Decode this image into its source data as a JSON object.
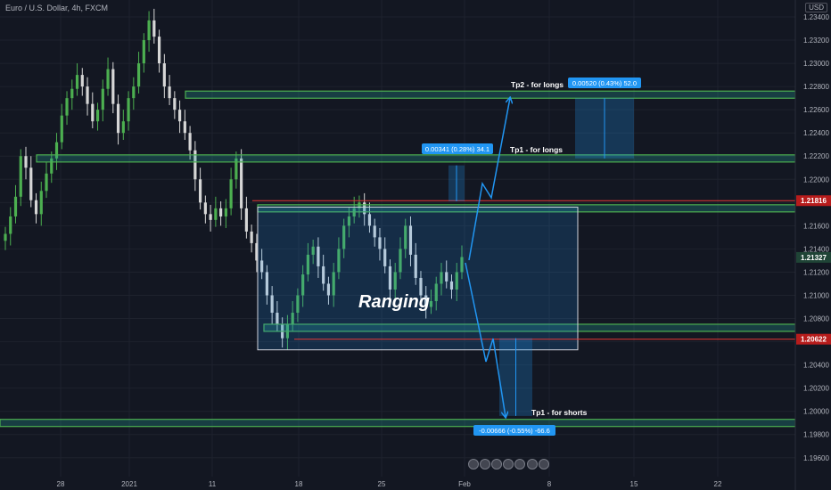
{
  "header": {
    "ticker": "Euro / U.S. Dollar, 4h, FXCM",
    "currency": "USD"
  },
  "chart_data": {
    "type": "candlestick",
    "ylim": [
      1.1946,
      1.234
    ],
    "y_ticks": [
      "1.23400",
      "1.23200",
      "1.23000",
      "1.22800",
      "1.22600",
      "1.22400",
      "1.22200",
      "1.22000",
      "1.21800",
      "1.21600",
      "1.21400",
      "1.21200",
      "1.21000",
      "1.20800",
      "1.20600",
      "1.20400",
      "1.20200",
      "1.20000",
      "1.19800",
      "1.19600"
    ],
    "x_ticks": [
      "28",
      "2021",
      "11",
      "18",
      "25",
      "Feb",
      "8",
      "15",
      "22"
    ],
    "price_badges": [
      {
        "label": "1.21816",
        "value": 1.21816,
        "color": "#b71c1c"
      },
      {
        "label": "1.21327",
        "value": 1.21327,
        "color": "#1f4436"
      },
      {
        "label": "1.20622",
        "value": 1.20622,
        "color": "#b71c1c"
      }
    ],
    "annotations": {
      "ranging": "Ranging",
      "tp2_longs": "Tp2 - for longs",
      "tp1_longs": "Tp1 - for longs",
      "tp1_shorts": "Tp1 - for shorts"
    },
    "measure_labels": {
      "box1": "0.00341 (0.28%) 34.1",
      "box2": "0.00520 (0.43%) 52.0",
      "box3": "-0.00666 (-0.55%) -66.6"
    },
    "levels": {
      "tp2_longs": 1.2273,
      "tp1_longs": 1.2218,
      "range_top": 1.2175,
      "resistance": 1.21816,
      "range_bottom": 1.2072,
      "support": 1.20622,
      "tp1_shorts": 1.199
    },
    "range_box": [
      1.2176,
      1.2053
    ],
    "series": [
      {
        "values": [
          1.2153,
          1.2168,
          1.2185,
          1.222,
          1.221,
          1.2182,
          1.217,
          1.219,
          1.2205,
          1.2218,
          1.2232,
          1.2255,
          1.227,
          1.2278,
          1.229,
          1.228,
          1.2265,
          1.225,
          1.226,
          1.2278,
          1.2295,
          1.2265,
          1.224,
          1.225,
          1.227,
          1.228,
          1.23,
          1.232,
          1.2337,
          1.2323,
          1.23,
          1.228,
          1.227,
          1.226,
          1.225,
          1.224,
          1.2225,
          1.22,
          1.218,
          1.217,
          1.2165,
          1.2175,
          1.2168,
          1.2175,
          1.22,
          1.2218,
          1.2175,
          1.2155,
          1.2145,
          1.213,
          1.212,
          1.21,
          1.2085,
          1.2075,
          1.2063,
          1.2075,
          1.2085,
          1.21,
          1.2118,
          1.2135,
          1.2142,
          1.2125,
          1.211,
          1.21,
          1.212,
          1.214,
          1.216,
          1.2168,
          1.2175,
          1.218,
          1.217,
          1.216,
          1.215,
          1.214,
          1.2125,
          1.2105,
          1.212,
          1.214,
          1.216,
          1.2135,
          1.2115,
          1.21,
          1.209,
          1.2095,
          1.211,
          1.212,
          1.2112,
          1.2105,
          1.212,
          1.2133
        ]
      }
    ]
  }
}
